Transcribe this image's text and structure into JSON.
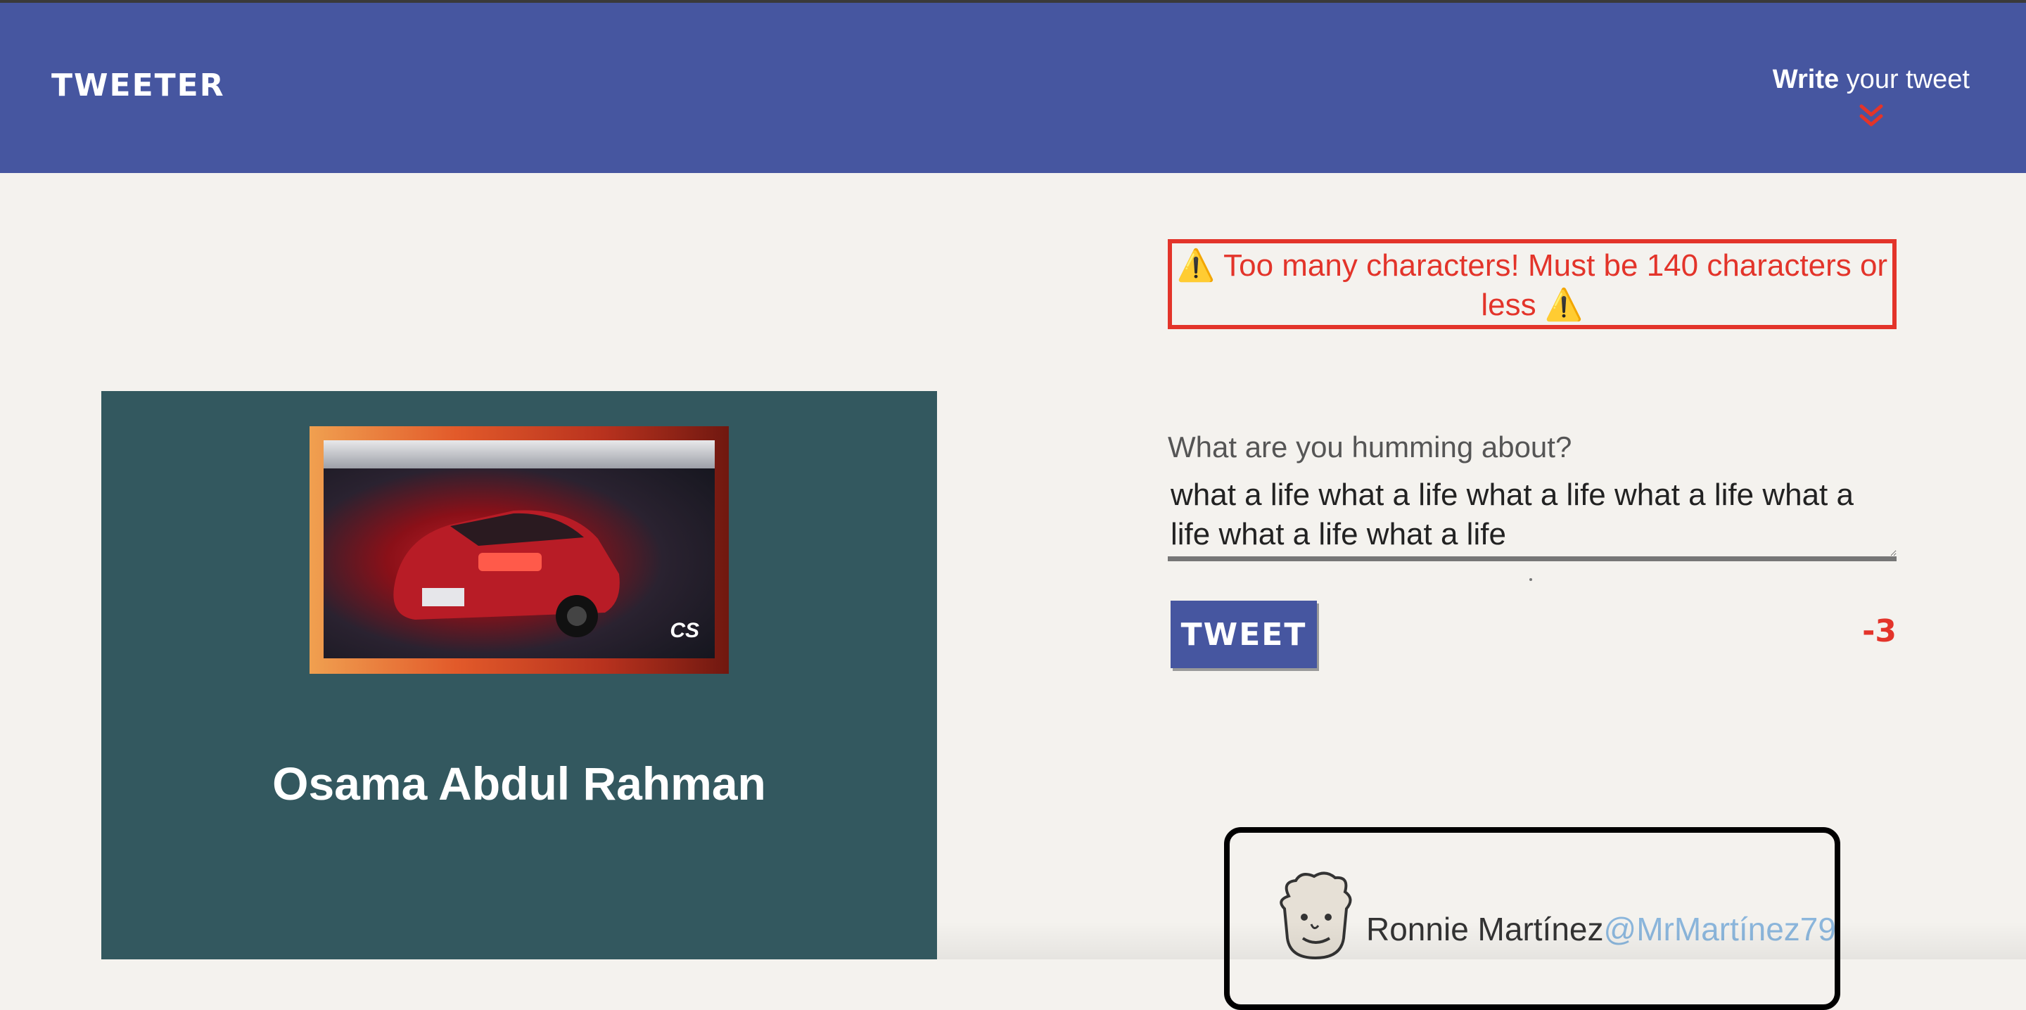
{
  "nav": {
    "brand": "TWEETER",
    "write_bold": "Write",
    "write_rest": " your tweet"
  },
  "profile": {
    "name": "Osama Abdul Rahman",
    "image_badge": "CS"
  },
  "compose": {
    "error": "⚠️ Too many characters! Must be 140 characters or less ⚠️",
    "label": "What are you humming about?",
    "value": "what a life what a life what a life what a life what a life what a life what a life",
    "button_label": "TWEET",
    "counter": "-3"
  },
  "tweet": {
    "author": "Ronnie Martínez",
    "handle": "@MrMartínez79"
  },
  "colors": {
    "nav_bg": "#4656a0",
    "page_bg": "#f4f2ee",
    "profile_bg": "#33585f",
    "error": "#e3342a",
    "handle": "#8bb6dc"
  },
  "icons": {
    "write_toggle": "double-chevron-down-icon",
    "tweet_avatar": "cartoon-face-icon"
  }
}
